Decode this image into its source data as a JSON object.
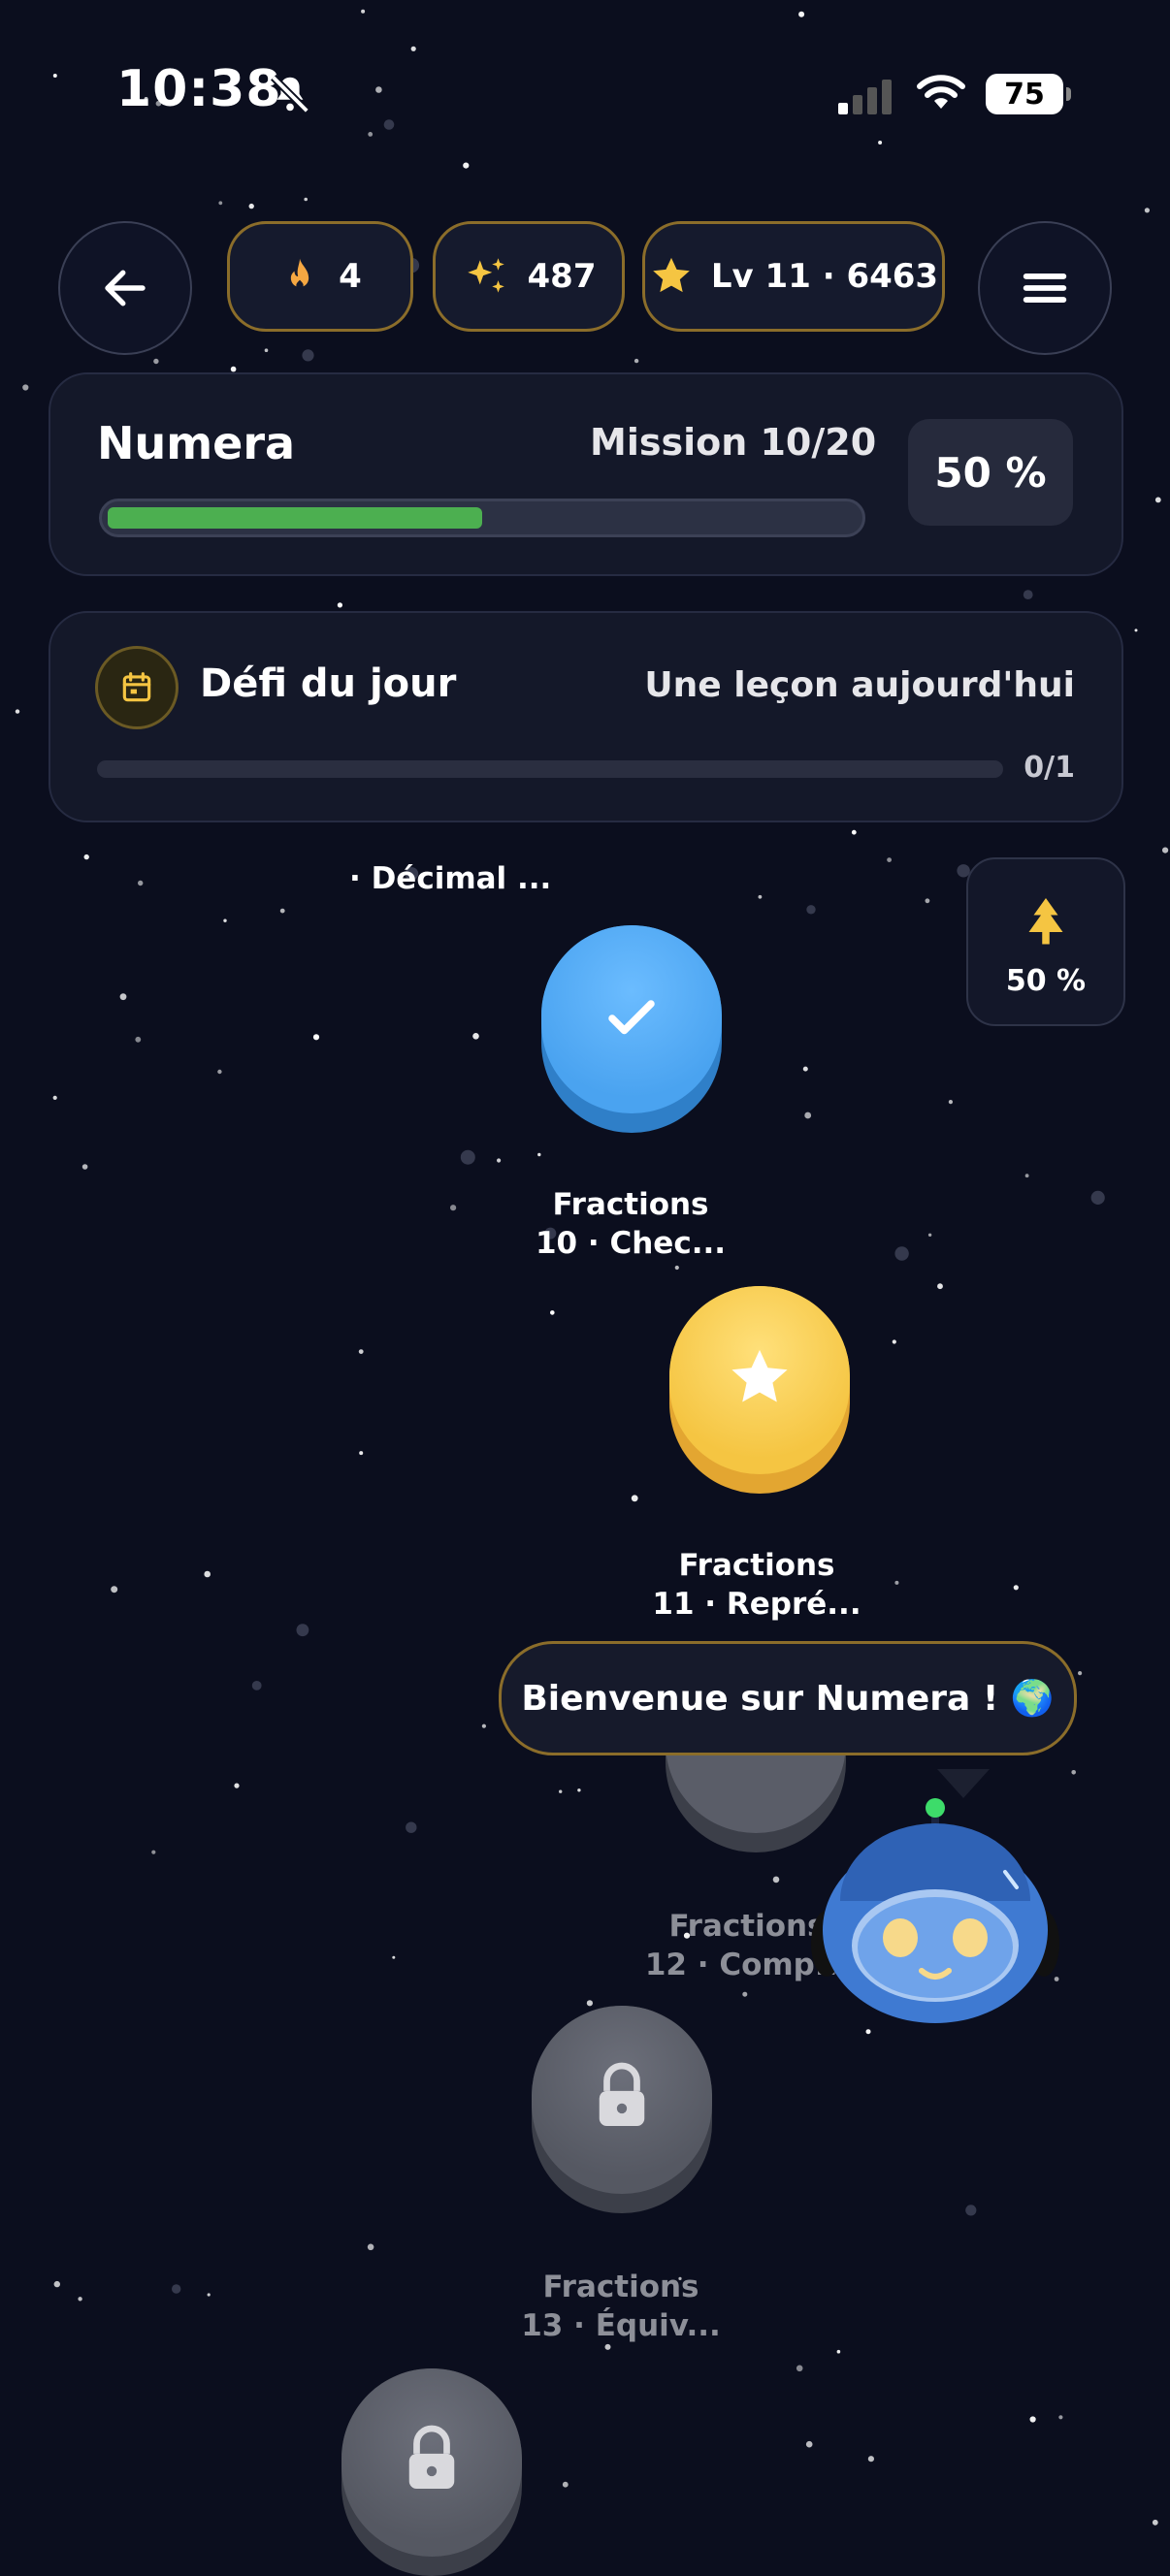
{
  "status_bar": {
    "time": "10:38",
    "battery": "75"
  },
  "header": {
    "streak": "4",
    "sparkles": "487",
    "level": "Lv 11 · 6463"
  },
  "course": {
    "title": "Numera",
    "mission": "Mission 10/20",
    "progress_percent": 50,
    "percent_label": "50 %"
  },
  "daily": {
    "title": "Défi du jour",
    "subtitle": "Une leçon aujourd'hui",
    "count": "0/1",
    "progress": 0
  },
  "path": {
    "top_label": "· Décimal ...",
    "tree_percent": "50 %",
    "nodes": [
      {
        "line1": "Fractions",
        "line2": "10 · Chec...",
        "state": "completed"
      },
      {
        "line1": "Fractions",
        "line2": "11 · Repré...",
        "state": "current"
      },
      {
        "line1": "Fractions",
        "line2": "12 · Comp...",
        "state": "locked"
      },
      {
        "line1": "Fractions",
        "line2": "13 · Équiv...",
        "state": "locked"
      },
      {
        "line1": "",
        "line2": "",
        "state": "locked"
      }
    ]
  },
  "mascot": {
    "bubble": "Bienvenue sur Numera ! 🌍"
  },
  "colors": {
    "accent_gold": "#f5c542",
    "progress_green": "#4caf50",
    "completed_blue": "#4aa3f0",
    "locked_gray": "#5a5d68"
  }
}
